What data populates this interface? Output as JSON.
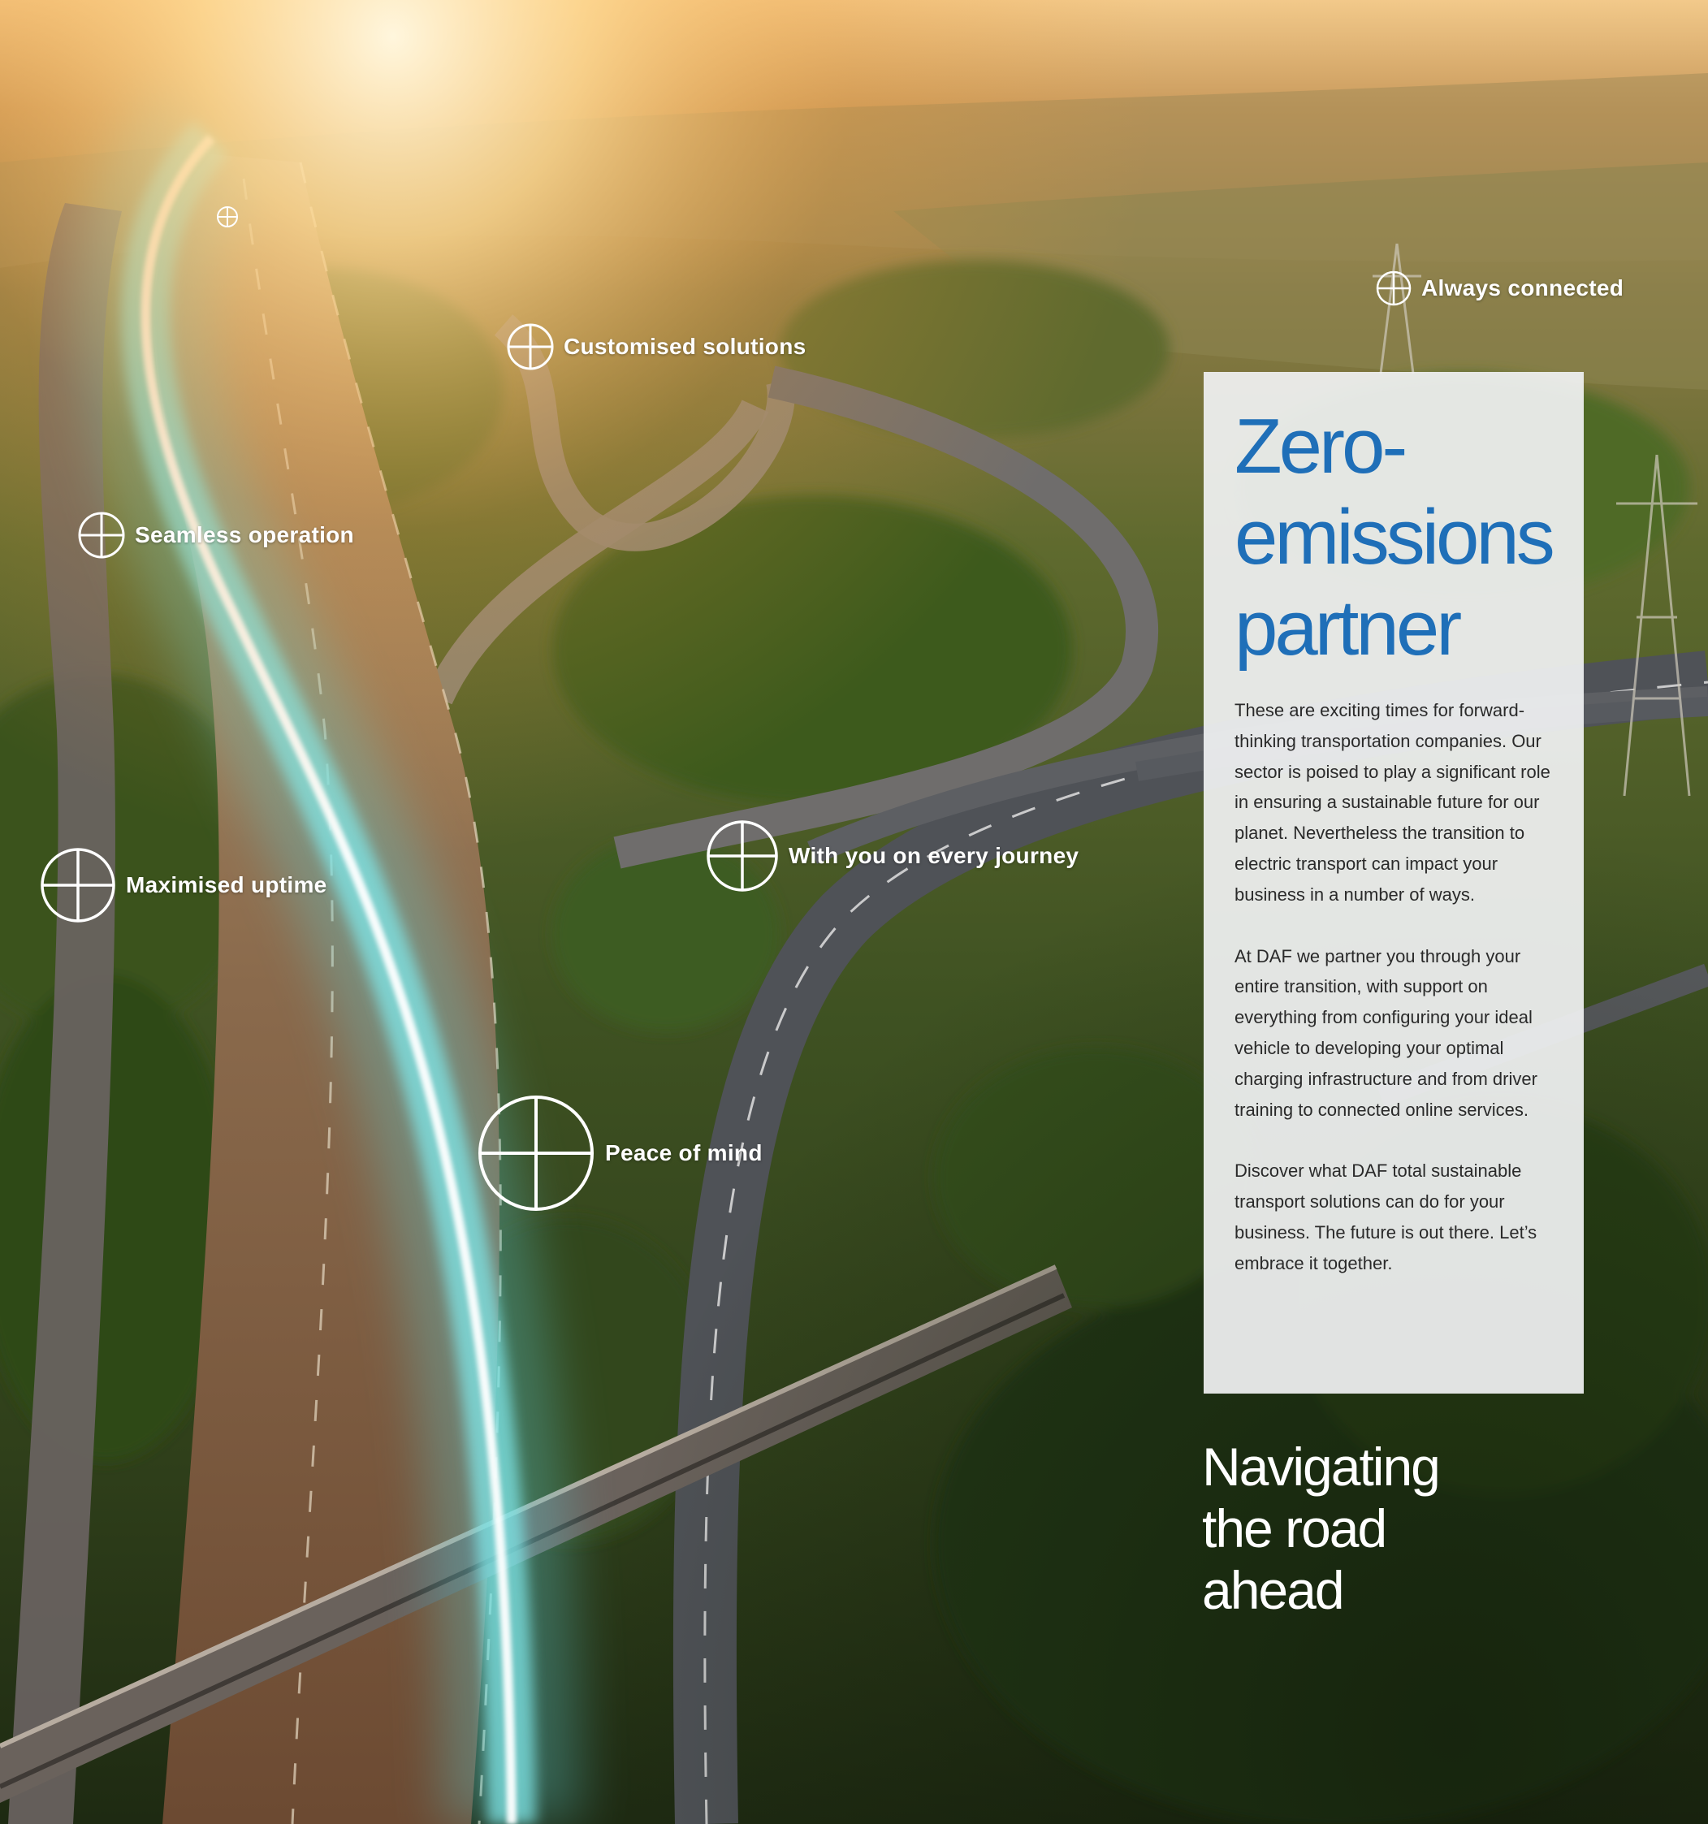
{
  "hotspots": [
    {
      "label": ""
    },
    {
      "label": "Always connected"
    },
    {
      "label": "Customised solutions"
    },
    {
      "label": "Seamless operation"
    },
    {
      "label": "With you on every journey"
    },
    {
      "label": "Maximised uptime"
    },
    {
      "label": "Peace of mind"
    }
  ],
  "panel": {
    "heading": [
      "Zero-",
      "emissions",
      "partner"
    ],
    "paragraphs": [
      "These are exciting times for forward-thinking transportation companies. Our sector is poised to play a significant role in ensuring a sustainable future for our planet. Nevertheless the transition to electric transport can impact your business in a number of ways.",
      "At DAF we partner you through your entire transition, with support on everything from configuring your ideal vehicle to developing your optimal charging infrastructure and from driver training to connected online services.",
      "Discover what DAF total sustainable transport solutions can do for your business. The future is out there. Let’s embrace it together."
    ]
  },
  "section_title": [
    "Navigating",
    "the road",
    "ahead"
  ],
  "colors": {
    "heading_blue": "#1f6fb8",
    "panel_bg": "#f0f1f2",
    "glow_teal": "#7fe6e8"
  },
  "icons": {
    "hotspot": "circle-plus-icon"
  }
}
